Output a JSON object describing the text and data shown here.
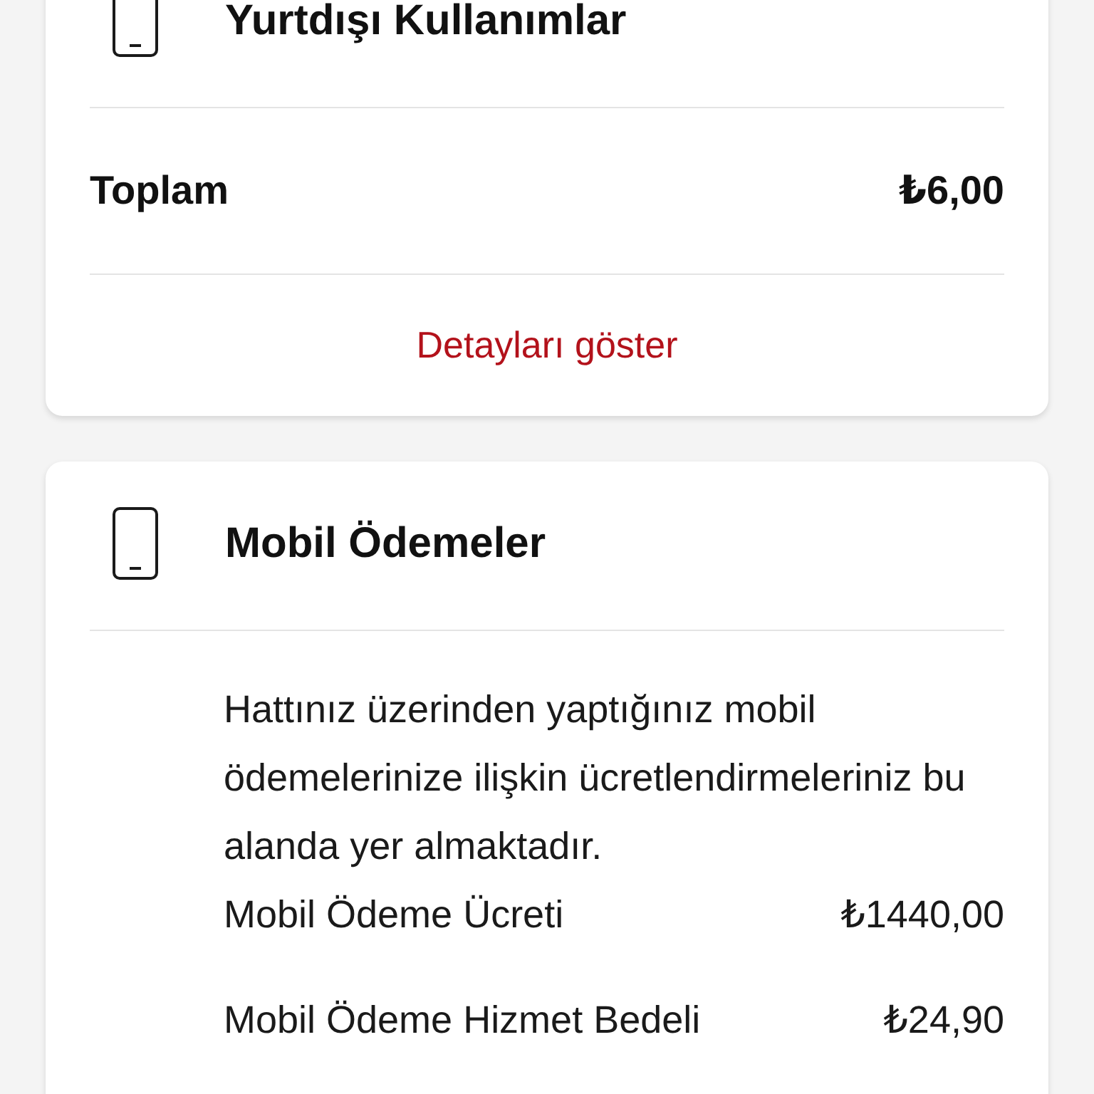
{
  "roaming_card": {
    "title": "Yurtdışı Kullanımlar",
    "total": {
      "label": "Toplam",
      "amount": "₺6,00"
    },
    "link": "Detayları göster"
  },
  "mobile_payments_card": {
    "title": "Mobil Ödemeler",
    "description": "Hattınız üzerinden yaptığınız mobil ödemelerinize ilişkin ücretlendirmeleriniz bu alanda yer almaktadır.",
    "items": [
      {
        "label": "Mobil Ödeme Ücreti",
        "amount": "₺1440,00"
      },
      {
        "label": "Mobil Ödeme Hizmet Bedeli",
        "amount": "₺24,90"
      }
    ]
  }
}
